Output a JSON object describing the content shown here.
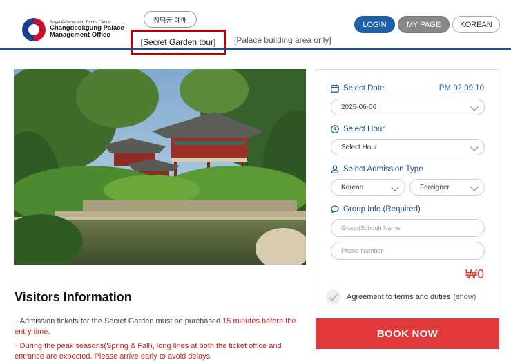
{
  "header": {
    "logo_sub": "Royal Palaces and Tombs Center",
    "logo_line1": "Changdeokgung Palace",
    "logo_line2": "Management Office",
    "korean_pill": "창덕궁 예매",
    "tab_secret": "[Secret Garden tour]",
    "tab_building": "[Palace building area only]",
    "login": "LOGIN",
    "mypage": "MY PAGE",
    "language": "KOREAN"
  },
  "colors": {
    "brand_blue": "#1f4e8c",
    "accent_red": "#e23a3a",
    "highlight_box": "#c00000"
  },
  "carousel": {
    "slides": 3,
    "active_index": 2
  },
  "visitors": {
    "title": "Visitors Information",
    "item1_text": "Admission tickets for the Secret Garden must be purchased ",
    "item1_red": "15 minutes before the entry time.",
    "item2": "During the peak seasons(Spring & Fall), long lines at both the ticket office and entrance are expected. Please arrive early to avoid delays."
  },
  "booking": {
    "select_date_label": "Select Date",
    "current_time": "PM 02:09:10",
    "date_value": "2025-06-06",
    "select_hour_label": "Select Hour",
    "hour_value": "Select Hour",
    "admission_label": "Select Admission Type",
    "admission_korean": "Korean",
    "admission_foreigner": "Foreigner",
    "group_label": "Group Info.(Required)",
    "group_name_placeholder": "Group(School) Name",
    "phone_placeholder": "Phone Number",
    "price": "₩0",
    "agreement": "Agreement to terms and duties",
    "agreement_show": "(show)",
    "book_now": "BOOK NOW"
  },
  "icons": [
    "calendar-icon",
    "clock-icon",
    "person-icon",
    "chat-icon",
    "checkmark-icon",
    "chevron-down-icon"
  ]
}
